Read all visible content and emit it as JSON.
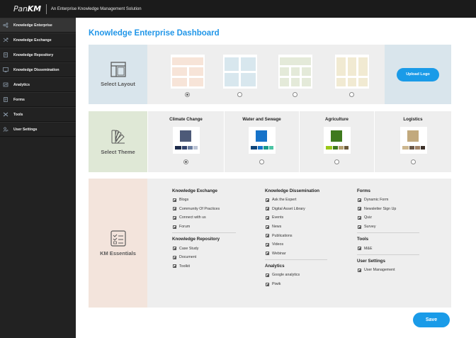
{
  "header": {
    "logo_pan": "Pan",
    "logo_km": "KM",
    "tagline": "An Enterprise Knowledge Management Solution"
  },
  "sidebar": {
    "items": [
      {
        "label": "Knowledge Enterprise",
        "icon": "network-icon",
        "active": true
      },
      {
        "label": "Knowledge Exchange",
        "icon": "exchange-arrows-icon"
      },
      {
        "label": "Knowledge Repository",
        "icon": "document-icon"
      },
      {
        "label": "Knowledge Dissemination",
        "icon": "monitor-icon"
      },
      {
        "label": "Analytics",
        "icon": "analytics-icon"
      },
      {
        "label": "Forms",
        "icon": "form-icon"
      },
      {
        "label": "Tools",
        "icon": "tools-icon"
      },
      {
        "label": "User Settings",
        "icon": "user-settings-icon"
      }
    ]
  },
  "main": {
    "title": "Knowledge Enterprise Dashboard",
    "layout": {
      "label": "Select Layout",
      "options": [
        {
          "color": "#f7e4d8",
          "selected": true
        },
        {
          "color": "#d8e7ee",
          "selected": false
        },
        {
          "color": "#e4ead9",
          "selected": false
        },
        {
          "color": "#f1ead2",
          "selected": false
        }
      ],
      "upload_label": "Upload Logo"
    },
    "theme": {
      "label": "Select Theme",
      "options": [
        {
          "name": "Climate Change",
          "main": "#4d5a78",
          "minis": [
            "#1c2a4a",
            "#33456e",
            "#6a7d9f",
            "#b9c2d3"
          ],
          "selected": true
        },
        {
          "name": "Water and Sewage",
          "main": "#1673c9",
          "minis": [
            "#10467a",
            "#1673c9",
            "#1a9a8a",
            "#4cc4a4"
          ],
          "selected": false
        },
        {
          "name": "Agriculture",
          "main": "#3f7a1e",
          "minis": [
            "#9bc81a",
            "#3f7a1e",
            "#b5a070",
            "#6b5a3a"
          ],
          "selected": false
        },
        {
          "name": "Logistics",
          "main": "#c2a97d",
          "minis": [
            "#cdb78f",
            "#6b5848",
            "#a08266",
            "#3c3028"
          ],
          "selected": false
        }
      ]
    },
    "essentials": {
      "label": "KM Essentials",
      "col1": [
        {
          "heading": "Knowledge Exchange",
          "items": [
            "Blogs",
            "Community Of Practices",
            "Connect with us",
            "Forum"
          ]
        },
        {
          "heading": "Knowledge Repository",
          "items": [
            "Case Study",
            "Document",
            "Toolkit"
          ]
        }
      ],
      "col2": [
        {
          "heading": "Knowledge Dissemination",
          "items": [
            "Ask the Expert",
            "Digital Asset Library",
            "Events",
            "News",
            "Publications",
            "Videos",
            "Webinar"
          ]
        },
        {
          "heading": "Analytics",
          "items": [
            "Google analytics",
            "Piwik"
          ]
        }
      ],
      "col3": [
        {
          "heading": "Forms",
          "items": [
            "Dynamic Form",
            "Newsletter Sign Up",
            "Quiz",
            "Survey"
          ]
        },
        {
          "heading": "Tools",
          "items": [
            "M&E"
          ]
        },
        {
          "heading": "User Settings",
          "items": [
            "User Management"
          ]
        }
      ]
    },
    "save_label": "Save"
  },
  "colors": {
    "accent": "#1a9be8",
    "topbar": "#1b1b1b",
    "sidebar": "#222222"
  }
}
